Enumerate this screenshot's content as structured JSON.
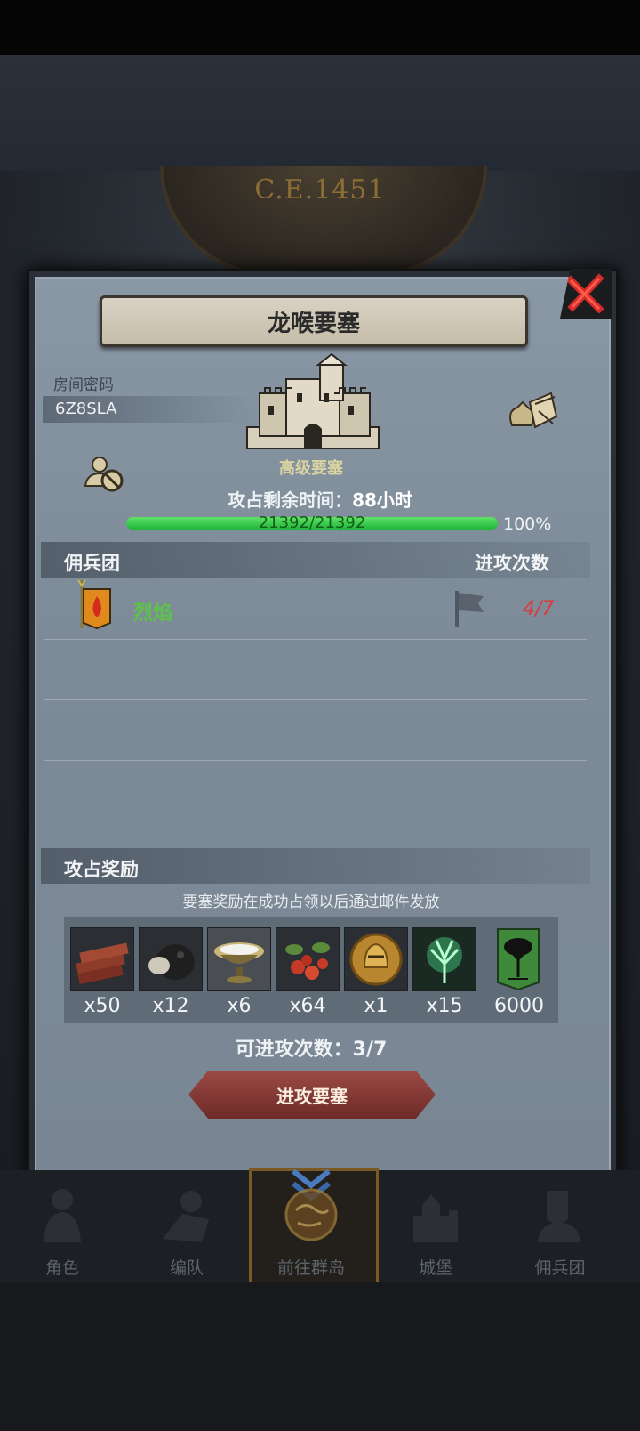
{
  "era": "C.E.1451",
  "modal": {
    "title": "龙喉要塞",
    "room_code_label": "房间密码",
    "room_code": "6Z8SLA",
    "fortress_type": "高级要塞",
    "remaining_label": "攻占剩余时间：",
    "remaining_value": "88小时",
    "hp_text": "21392/21392",
    "hp_fraction": 1.0,
    "hp_percent": "100%"
  },
  "mercenaries": {
    "header_left": "佣兵团",
    "header_right": "进攻次数",
    "rows": [
      {
        "name": "烈焰",
        "count": "4/7"
      }
    ]
  },
  "rewards": {
    "header": "攻占奖励",
    "note": "要塞奖励在成功占领以后通过邮件发放",
    "items": [
      {
        "icon": "timber-icon",
        "qty": "x50"
      },
      {
        "icon": "ore-icon",
        "qty": "x12"
      },
      {
        "icon": "salt-bowl-icon",
        "qty": "x6"
      },
      {
        "icon": "berries-icon",
        "qty": "x64"
      },
      {
        "icon": "golden-helmet-medal-icon",
        "qty": "x1"
      },
      {
        "icon": "green-spirit-tree-icon",
        "qty": "x15"
      },
      {
        "icon": "tree-banner-icon",
        "qty": "6000"
      }
    ]
  },
  "attempts_text": "可进攻次数：3/7",
  "attack_button": "进攻要塞",
  "nav": [
    {
      "label": "角色",
      "icon": "knight-icon"
    },
    {
      "label": "编队",
      "icon": "formation-icon"
    },
    {
      "label": "前往群岛",
      "icon": "islands-globe-icon"
    },
    {
      "label": "城堡",
      "icon": "castle-icon"
    },
    {
      "label": "佣兵团",
      "icon": "mercenary-icon"
    }
  ],
  "colors": {
    "hp_green": "#2fc844",
    "merc_name": "#5dc24a",
    "merc_count": "#d93b3b",
    "attack_button": "#8a3c38",
    "close_red": "#d42b2b"
  }
}
